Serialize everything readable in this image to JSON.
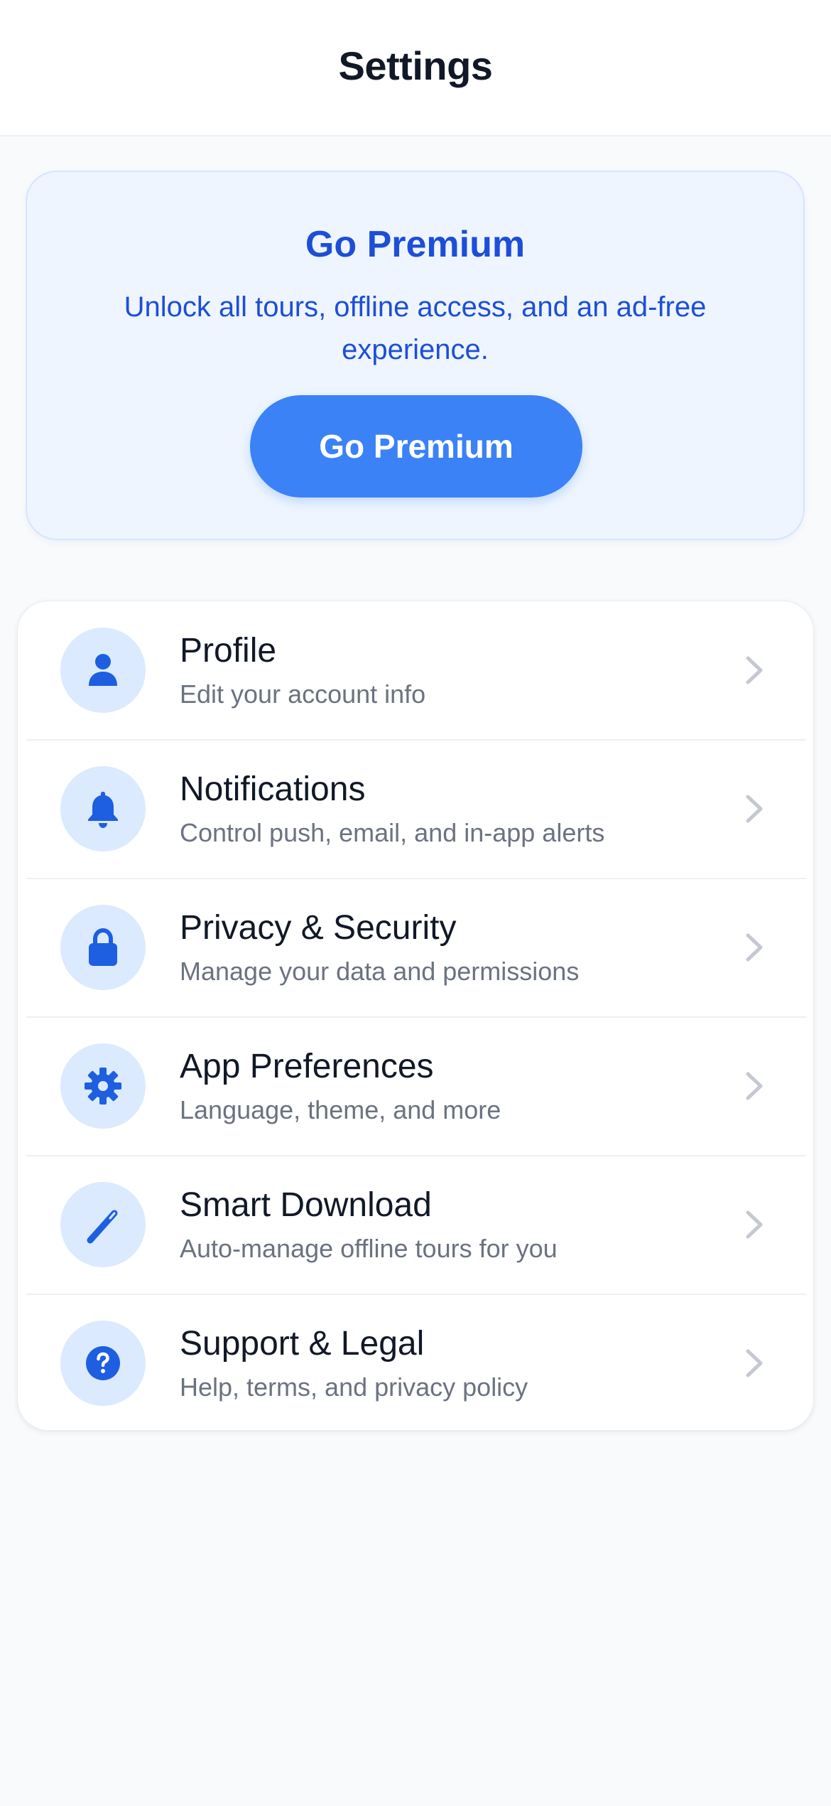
{
  "header": {
    "title": "Settings"
  },
  "premium": {
    "title": "Go Premium",
    "description": "Unlock all tours, offline access, and an ad-free experience.",
    "button_label": "Go Premium"
  },
  "settings": {
    "items": [
      {
        "title": "Profile",
        "subtitle": "Edit your account info",
        "icon": "person-icon"
      },
      {
        "title": "Notifications",
        "subtitle": "Control push, email, and in-app alerts",
        "icon": "bell-icon"
      },
      {
        "title": "Privacy & Security",
        "subtitle": "Manage your data and permissions",
        "icon": "lock-icon"
      },
      {
        "title": "App Preferences",
        "subtitle": "Language, theme, and more",
        "icon": "gear-icon"
      },
      {
        "title": "Smart Download",
        "subtitle": "Auto-manage offline tours for you",
        "icon": "magic-wand-icon"
      },
      {
        "title": "Support & Legal",
        "subtitle": "Help, terms, and privacy policy",
        "icon": "question-circle-icon"
      }
    ]
  },
  "colors": {
    "accent": "#3b82f6",
    "accent_dark": "#1d4ed8",
    "icon_bg": "#dbeafe",
    "premium_bg": "#eef5ff",
    "page_bg": "#f8fafc",
    "title_text": "#111827",
    "subtitle_text": "#6b7280",
    "chevron": "#c4c9d1"
  }
}
